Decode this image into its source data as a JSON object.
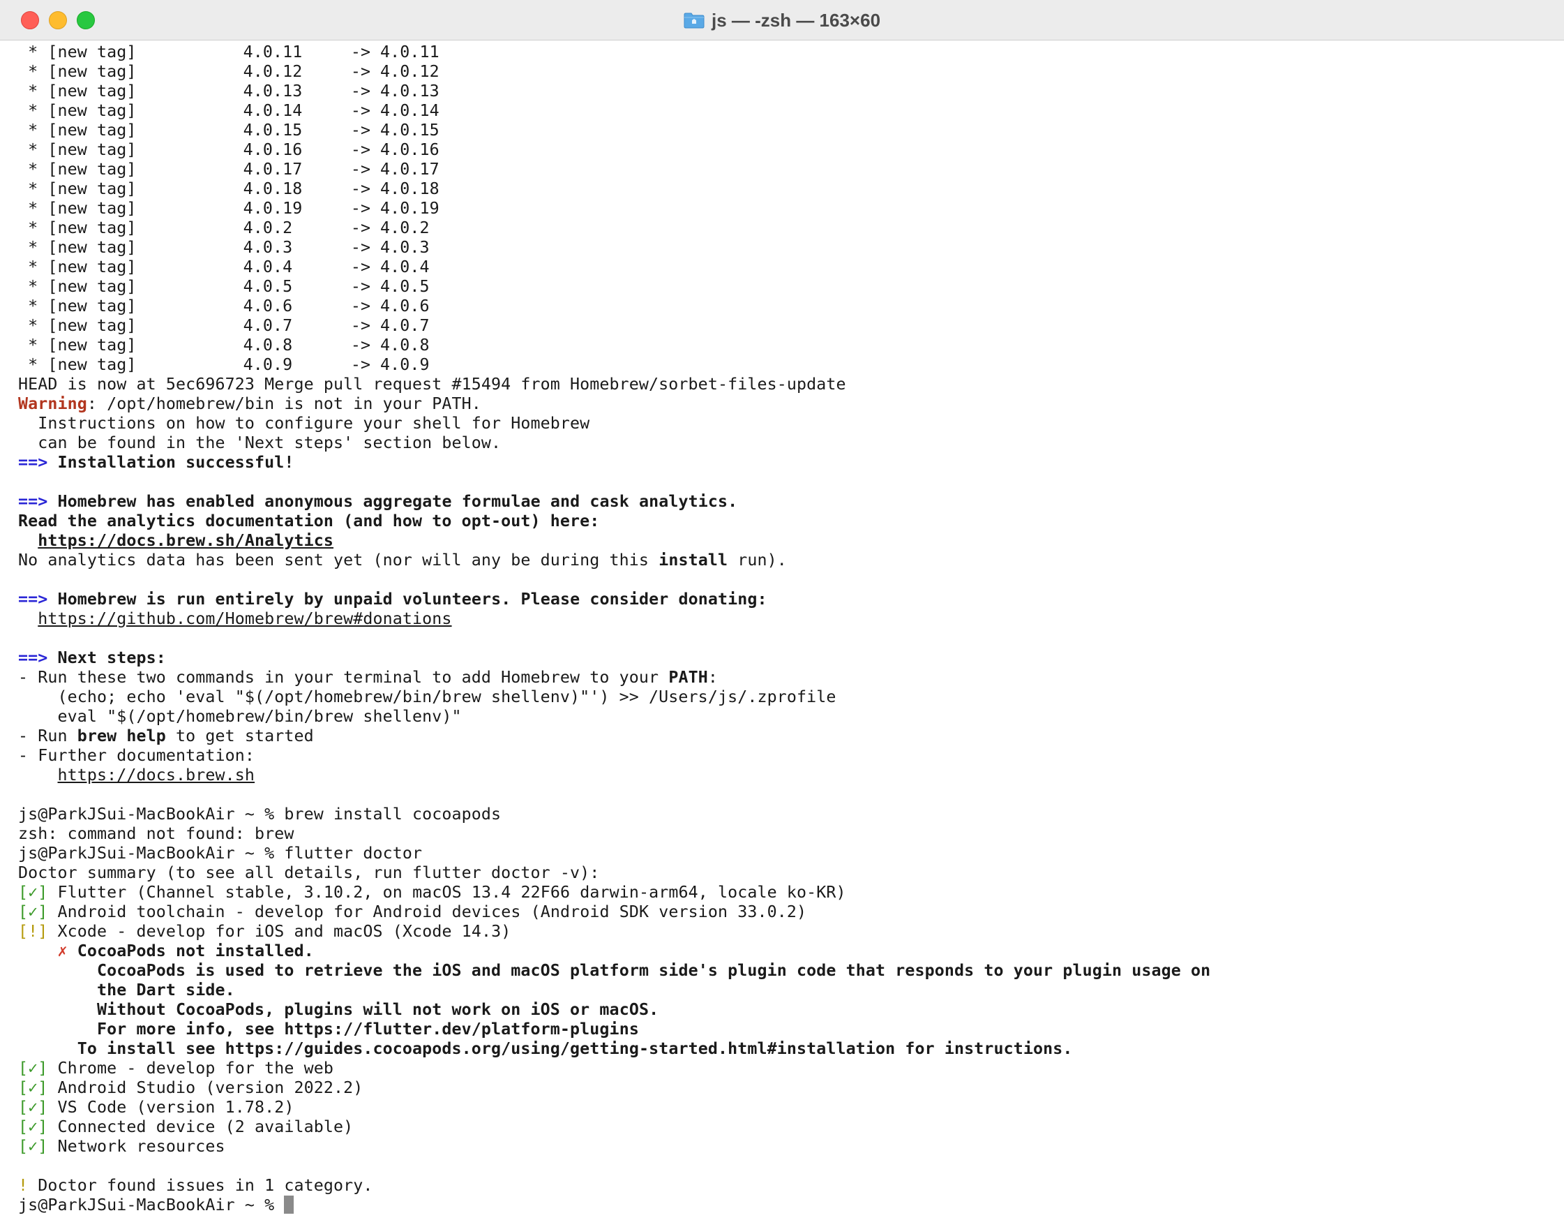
{
  "window": {
    "title": "js — -zsh — 163×60",
    "title_icon": "folder-icon",
    "colors": {
      "close": "#ff5f57",
      "minimize": "#febc2e",
      "zoom": "#28c840"
    }
  },
  "colors": {
    "arrow": "#2a26d6",
    "warning": "#b2361f",
    "check": "#3c9a2a",
    "notice": "#b59b0e",
    "error": "#d23b2b"
  },
  "tags": [
    {
      "bullet": " * [new tag]",
      "from": "4.0.11",
      "arrow": "->",
      "to": "4.0.11"
    },
    {
      "bullet": " * [new tag]",
      "from": "4.0.12",
      "arrow": "->",
      "to": "4.0.12"
    },
    {
      "bullet": " * [new tag]",
      "from": "4.0.13",
      "arrow": "->",
      "to": "4.0.13"
    },
    {
      "bullet": " * [new tag]",
      "from": "4.0.14",
      "arrow": "->",
      "to": "4.0.14"
    },
    {
      "bullet": " * [new tag]",
      "from": "4.0.15",
      "arrow": "->",
      "to": "4.0.15"
    },
    {
      "bullet": " * [new tag]",
      "from": "4.0.16",
      "arrow": "->",
      "to": "4.0.16"
    },
    {
      "bullet": " * [new tag]",
      "from": "4.0.17",
      "arrow": "->",
      "to": "4.0.17"
    },
    {
      "bullet": " * [new tag]",
      "from": "4.0.18",
      "arrow": "->",
      "to": "4.0.18"
    },
    {
      "bullet": " * [new tag]",
      "from": "4.0.19",
      "arrow": "->",
      "to": "4.0.19"
    },
    {
      "bullet": " * [new tag]",
      "from": "4.0.2",
      "arrow": "->",
      "to": "4.0.2"
    },
    {
      "bullet": " * [new tag]",
      "from": "4.0.3",
      "arrow": "->",
      "to": "4.0.3"
    },
    {
      "bullet": " * [new tag]",
      "from": "4.0.4",
      "arrow": "->",
      "to": "4.0.4"
    },
    {
      "bullet": " * [new tag]",
      "from": "4.0.5",
      "arrow": "->",
      "to": "4.0.5"
    },
    {
      "bullet": " * [new tag]",
      "from": "4.0.6",
      "arrow": "->",
      "to": "4.0.6"
    },
    {
      "bullet": " * [new tag]",
      "from": "4.0.7",
      "arrow": "->",
      "to": "4.0.7"
    },
    {
      "bullet": " * [new tag]",
      "from": "4.0.8",
      "arrow": "->",
      "to": "4.0.8"
    },
    {
      "bullet": " * [new tag]",
      "from": "4.0.9",
      "arrow": "->",
      "to": "4.0.9"
    }
  ],
  "head_line": "HEAD is now at 5ec696723 Merge pull request #15494 from Homebrew/sorbet-files-update",
  "warning": {
    "label": "Warning",
    "text": ": /opt/homebrew/bin is not in your PATH.",
    "detail1": "  Instructions on how to configure your shell for Homebrew",
    "detail2": "  can be found in the 'Next steps' section below."
  },
  "arrow_marker": "==>",
  "install_success": "Installation successful!",
  "analytics": {
    "heading": "Homebrew has enabled anonymous aggregate formulae and cask analytics.",
    "read": "Read the analytics documentation (and how to opt-out) here:",
    "url": "https://docs.brew.sh/Analytics",
    "note_pre": "No analytics data has been sent yet (nor will any be during this ",
    "note_bold": "install",
    "note_post": " run)."
  },
  "donate": {
    "heading": "Homebrew is run entirely by unpaid volunteers. Please consider donating:",
    "url": "https://github.com/Homebrew/brew#donations"
  },
  "next_steps": {
    "heading": "Next steps:",
    "run_two_pre": "- Run these two commands in your terminal to add Homebrew to your ",
    "run_two_bold": "PATH",
    "run_two_post": ":",
    "cmd1": "    (echo; echo 'eval \"$(/opt/homebrew/bin/brew shellenv)\"') >> /Users/js/.zprofile",
    "cmd2": "    eval \"$(/opt/homebrew/bin/brew shellenv)\"",
    "run_help_pre": "- Run ",
    "run_help_bold": "brew help",
    "run_help_post": " to get started",
    "further": "- Further documentation:",
    "docs_url": "https://docs.brew.sh"
  },
  "session": {
    "cmd_brew": "js@ParkJSui-MacBookAir ~ % brew install cocoapods",
    "brew_error": "zsh: command not found: brew",
    "cmd_flutter": "js@ParkJSui-MacBookAir ~ % flutter doctor",
    "summary": "Doctor summary (to see all details, run flutter doctor -v):",
    "check_mark": "[✓]",
    "warn_mark": "[!]",
    "cross_mark": "✗",
    "flutter": "Flutter (Channel stable, 3.10.2, on macOS 13.4 22F66 darwin-arm64, locale ko-KR)",
    "android_toolchain": "Android toolchain - develop for Android devices (Android SDK version 33.0.2)",
    "xcode": "Xcode - develop for iOS and macOS (Xcode 14.3)",
    "cocoapods_missing": "CocoaPods not installed.",
    "cocoapods_1": "CocoaPods is used to retrieve the iOS and macOS platform side's plugin code that responds to your plugin usage on",
    "cocoapods_2": "the Dart side.",
    "cocoapods_3": "Without CocoaPods, plugins will not work on iOS or macOS.",
    "cocoapods_4": "For more info, see https://flutter.dev/platform-plugins",
    "cocoapods_install": "To install see https://guides.cocoapods.org/using/getting-started.html#installation for instructions.",
    "chrome": "Chrome - develop for the web",
    "android_studio": "Android Studio (version 2022.2)",
    "vscode": "VS Code (version 1.78.2)",
    "connected": "Connected device (2 available)",
    "network": "Network resources",
    "issues_mark": "!",
    "issues": "Doctor found issues in 1 category.",
    "prompt": "js@ParkJSui-MacBookAir ~ % "
  }
}
